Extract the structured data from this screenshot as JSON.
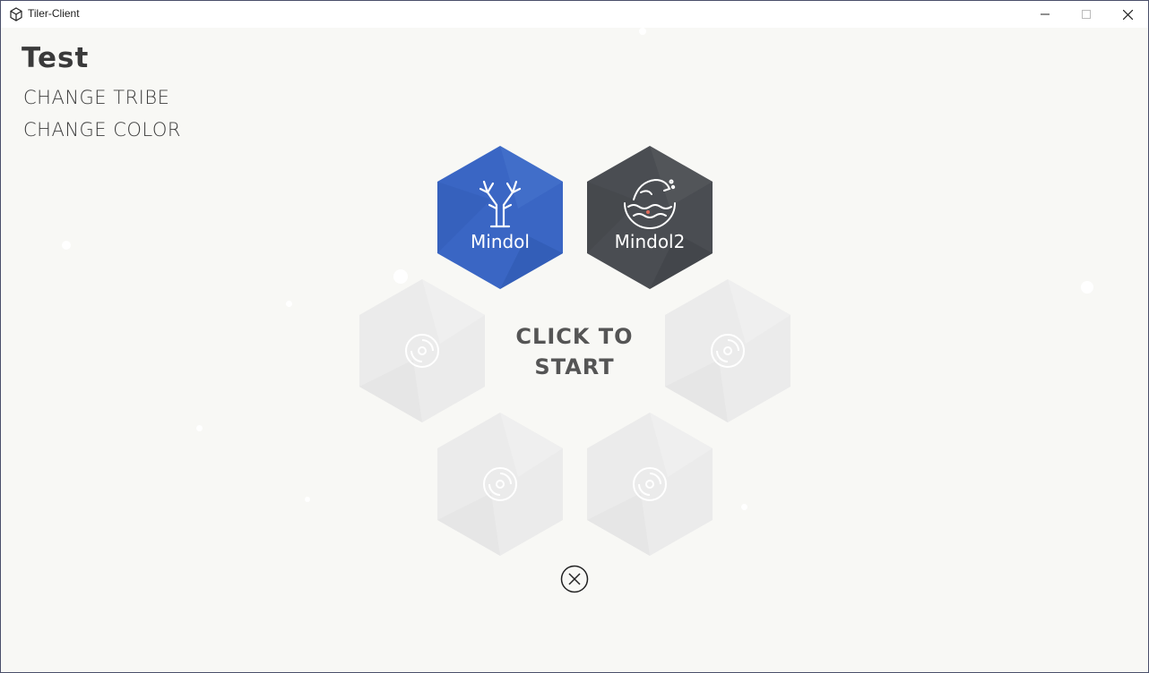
{
  "window": {
    "title": "Tiler-Client"
  },
  "player": {
    "name": "Test"
  },
  "menu": {
    "change_tribe": "CHANGE TRIBE",
    "change_color": "CHANGE COLOR"
  },
  "tribes": [
    {
      "name": "Mindol",
      "icon": "tree-icon",
      "color": "#3a66c4"
    },
    {
      "name": "Mindol2",
      "icon": "dolphin-wave-icon",
      "color": "#4a4d52"
    }
  ],
  "empty_slot_icon": "disc-icon",
  "empty_slot_color": "#ebebeb",
  "start": {
    "label": "CLICK TO START"
  },
  "colors": {
    "background": "#f8f8f5",
    "text": "#3a3a3a",
    "start_text": "#555555"
  }
}
